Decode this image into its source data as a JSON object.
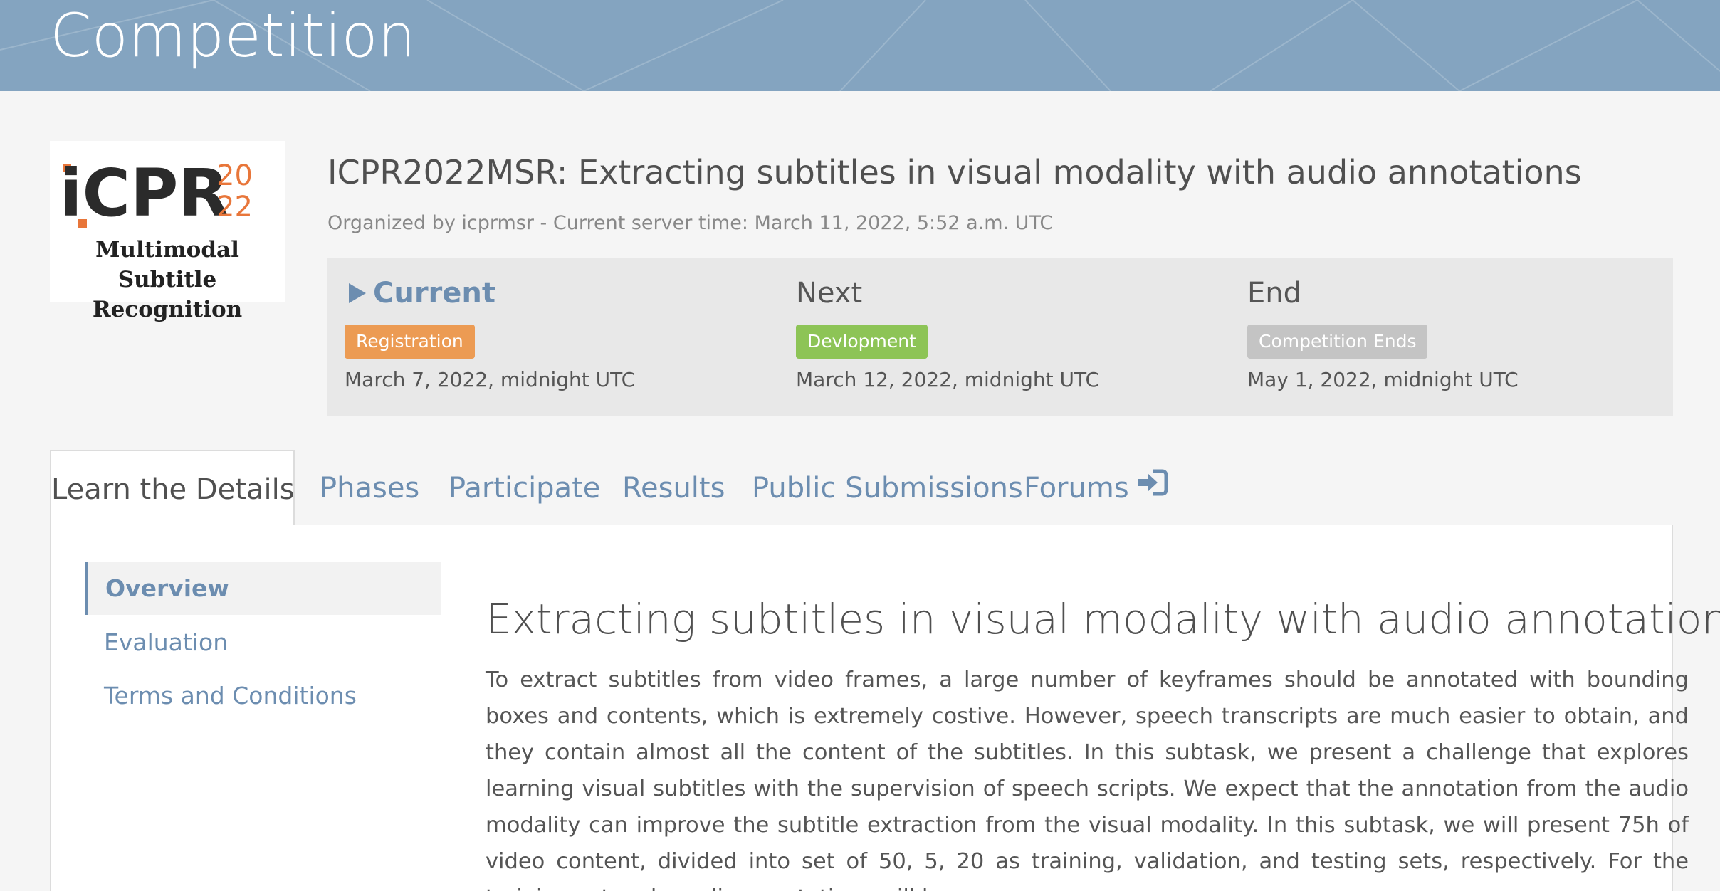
{
  "banner": {
    "title": "Competition"
  },
  "logo": {
    "letters": "iCPR",
    "year_top": "20",
    "year_bottom": "22",
    "caption_line1": "Multimodal Subtitle",
    "caption_line2": "Recognition"
  },
  "competition": {
    "title": "ICPR2022MSR: Extracting subtitles in visual modality with audio annotations",
    "organized": "Organized by icprmsr - Current server time: March 11, 2022, 5:52 a.m. UTC"
  },
  "phases": [
    {
      "heading": "Current",
      "badge": "Registration",
      "date": "March 7, 2022, midnight UTC",
      "color": "#ec9b53"
    },
    {
      "heading": "Next",
      "badge": "Devlopment",
      "date": "March 12, 2022, midnight UTC",
      "color": "#8dc456"
    },
    {
      "heading": "End",
      "badge": "Competition Ends",
      "date": "May 1, 2022, midnight UTC",
      "color": "#c4c4c4"
    }
  ],
  "tabs": [
    {
      "label": "Learn the Details"
    },
    {
      "label": "Phases"
    },
    {
      "label": "Participate"
    },
    {
      "label": "Results"
    },
    {
      "label": "Public Submissions"
    },
    {
      "label": "Forums",
      "icon": "sign-in-icon"
    }
  ],
  "sidebar": {
    "items": [
      {
        "label": "Overview"
      },
      {
        "label": "Evaluation"
      },
      {
        "label": "Terms and Conditions"
      }
    ]
  },
  "content": {
    "title": "Extracting subtitles in visual modality with audio annotations",
    "body": "To extract subtitles from video frames, a large number of keyframes should be annotated with bounding boxes and contents, which is extremely costive. However, speech transcripts are much easier to obtain, and they contain almost all the content of the subtitles. In this subtask, we present a challenge that explores learning visual subtitles with the supervision of speech scripts. We expect that the annotation from the audio modality can improve the subtitle extraction from the visual modality. In this subtask, we will present 75h of video content, divided into set of 50, 5, 20 as training, validation, and testing sets, respectively. For the training set, only audio annotations will be"
  },
  "colors": {
    "banner": "#84a4c0",
    "accent": "#6c8db0",
    "logo_orange": "#e8763a"
  }
}
